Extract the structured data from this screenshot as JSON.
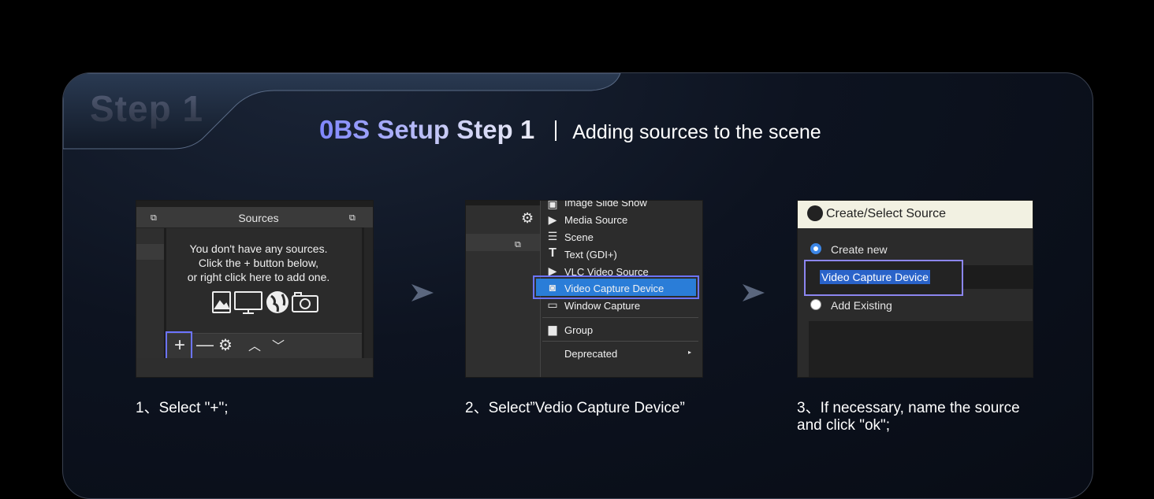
{
  "badge": "Step 1",
  "heading": {
    "main": "0BS Setup Step 1",
    "subtitle": "Adding sources to the scene"
  },
  "colors": {
    "accent": "#6c74ff",
    "highlight_blue": "#2a7dd8",
    "background": "#000000"
  },
  "screens": {
    "s1": {
      "panel_title": "Sources",
      "empty_message_1": "You don't have any sources.",
      "empty_message_2": "Click the + button below,",
      "empty_message_3": "or right click here to add one.",
      "toolbar_icons": [
        "plus-icon",
        "minus-icon",
        "gear-icon",
        "chevron-up-icon",
        "chevron-down-icon"
      ],
      "placeholder_icons": [
        "image-icon",
        "monitor-icon",
        "globe-icon",
        "camera-icon"
      ]
    },
    "s2": {
      "menu_items": [
        "Image Slide Show",
        "Media Source",
        "Scene",
        "Text (GDI+)",
        "VLC Video Source",
        "Video Capture Device",
        "Window Capture",
        "Group",
        "Deprecated"
      ],
      "selected_item": "Video Capture Device"
    },
    "s3": {
      "dialog_title": "Create/Select Source",
      "option_create": "Create new",
      "option_existing": "Add Existing",
      "source_name_value": "Video Capture Device"
    }
  },
  "captions": {
    "c1": "1、Select \"+\";",
    "c2": "2、Select”Vedio Capture Device”",
    "c3_line1": "3、If necessary, name the source",
    "c3_line2": "and click \"ok\";"
  }
}
